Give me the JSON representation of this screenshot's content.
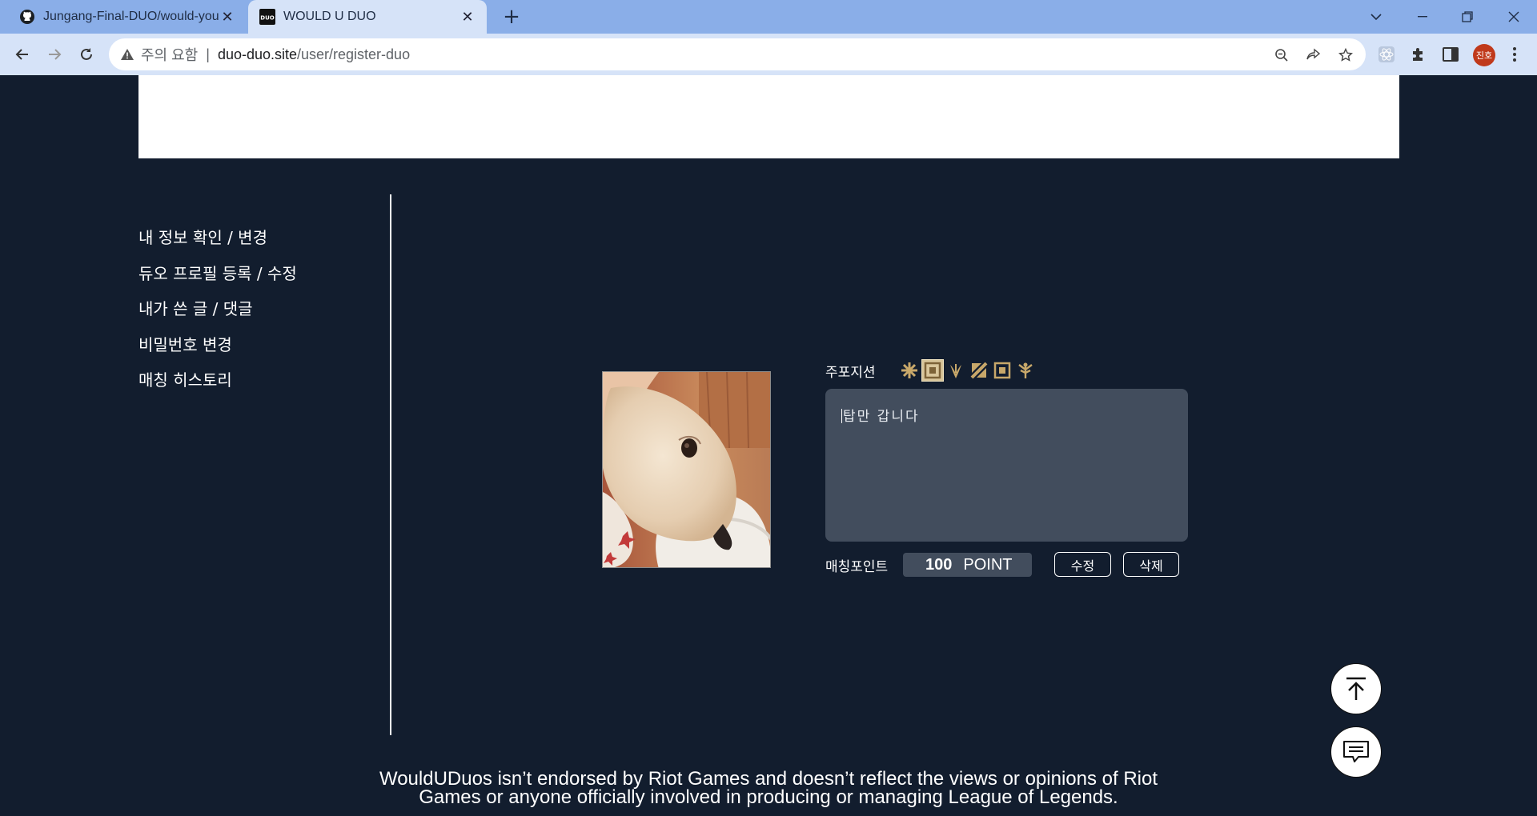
{
  "browser": {
    "tabs": [
      {
        "title": "Jungang-Final-DUO/would-you-",
        "icon": "github-icon"
      },
      {
        "title": "WOULD U DUO",
        "icon": "duo-logo-icon"
      }
    ],
    "favicon_text": "DUO",
    "address": {
      "security_label": "주의 요함",
      "separator": "|",
      "host": "duo-duo.site",
      "path": "/user/register-duo"
    },
    "profile_initials": "진호"
  },
  "sidebar": {
    "items": [
      {
        "label": "내 정보 확인 / 변경"
      },
      {
        "label": "듀오 프로필 등록 / 수정"
      },
      {
        "label": "내가 쓴 글 / 댓글"
      },
      {
        "label": "비밀번호 변경"
      },
      {
        "label": "매칭 히스토리"
      }
    ]
  },
  "profile": {
    "position_label": "주포지션",
    "positions": [
      {
        "name": "top",
        "icon": "position-top-icon",
        "selected": false
      },
      {
        "name": "jungle",
        "icon": "position-jungle-icon",
        "selected": true
      },
      {
        "name": "mid",
        "icon": "position-mid-icon",
        "selected": false
      },
      {
        "name": "bottom",
        "icon": "position-bottom-icon",
        "selected": false
      },
      {
        "name": "support",
        "icon": "position-support-icon",
        "selected": false
      },
      {
        "name": "all",
        "icon": "position-all-icon",
        "selected": false
      }
    ],
    "memo_text": "탑만 갑니다",
    "matching_point_label": "매칭포인트",
    "matching_point_value": "100",
    "matching_point_unit": "POINT",
    "edit_label": "수정",
    "delete_label": "삭제"
  },
  "footer": {
    "disclaimer": "WouldUDuos isn’t endorsed by Riot Games and doesn’t reflect the views or opinions of Riot Games or anyone officially involved in producing or managing League of Legends."
  },
  "colors": {
    "page_background": "#121d2e",
    "memo_background": "#424d5d",
    "position_accent": "#c8a86a",
    "tabbar": "#8aaee8",
    "toolbar": "#d6e3f8"
  }
}
